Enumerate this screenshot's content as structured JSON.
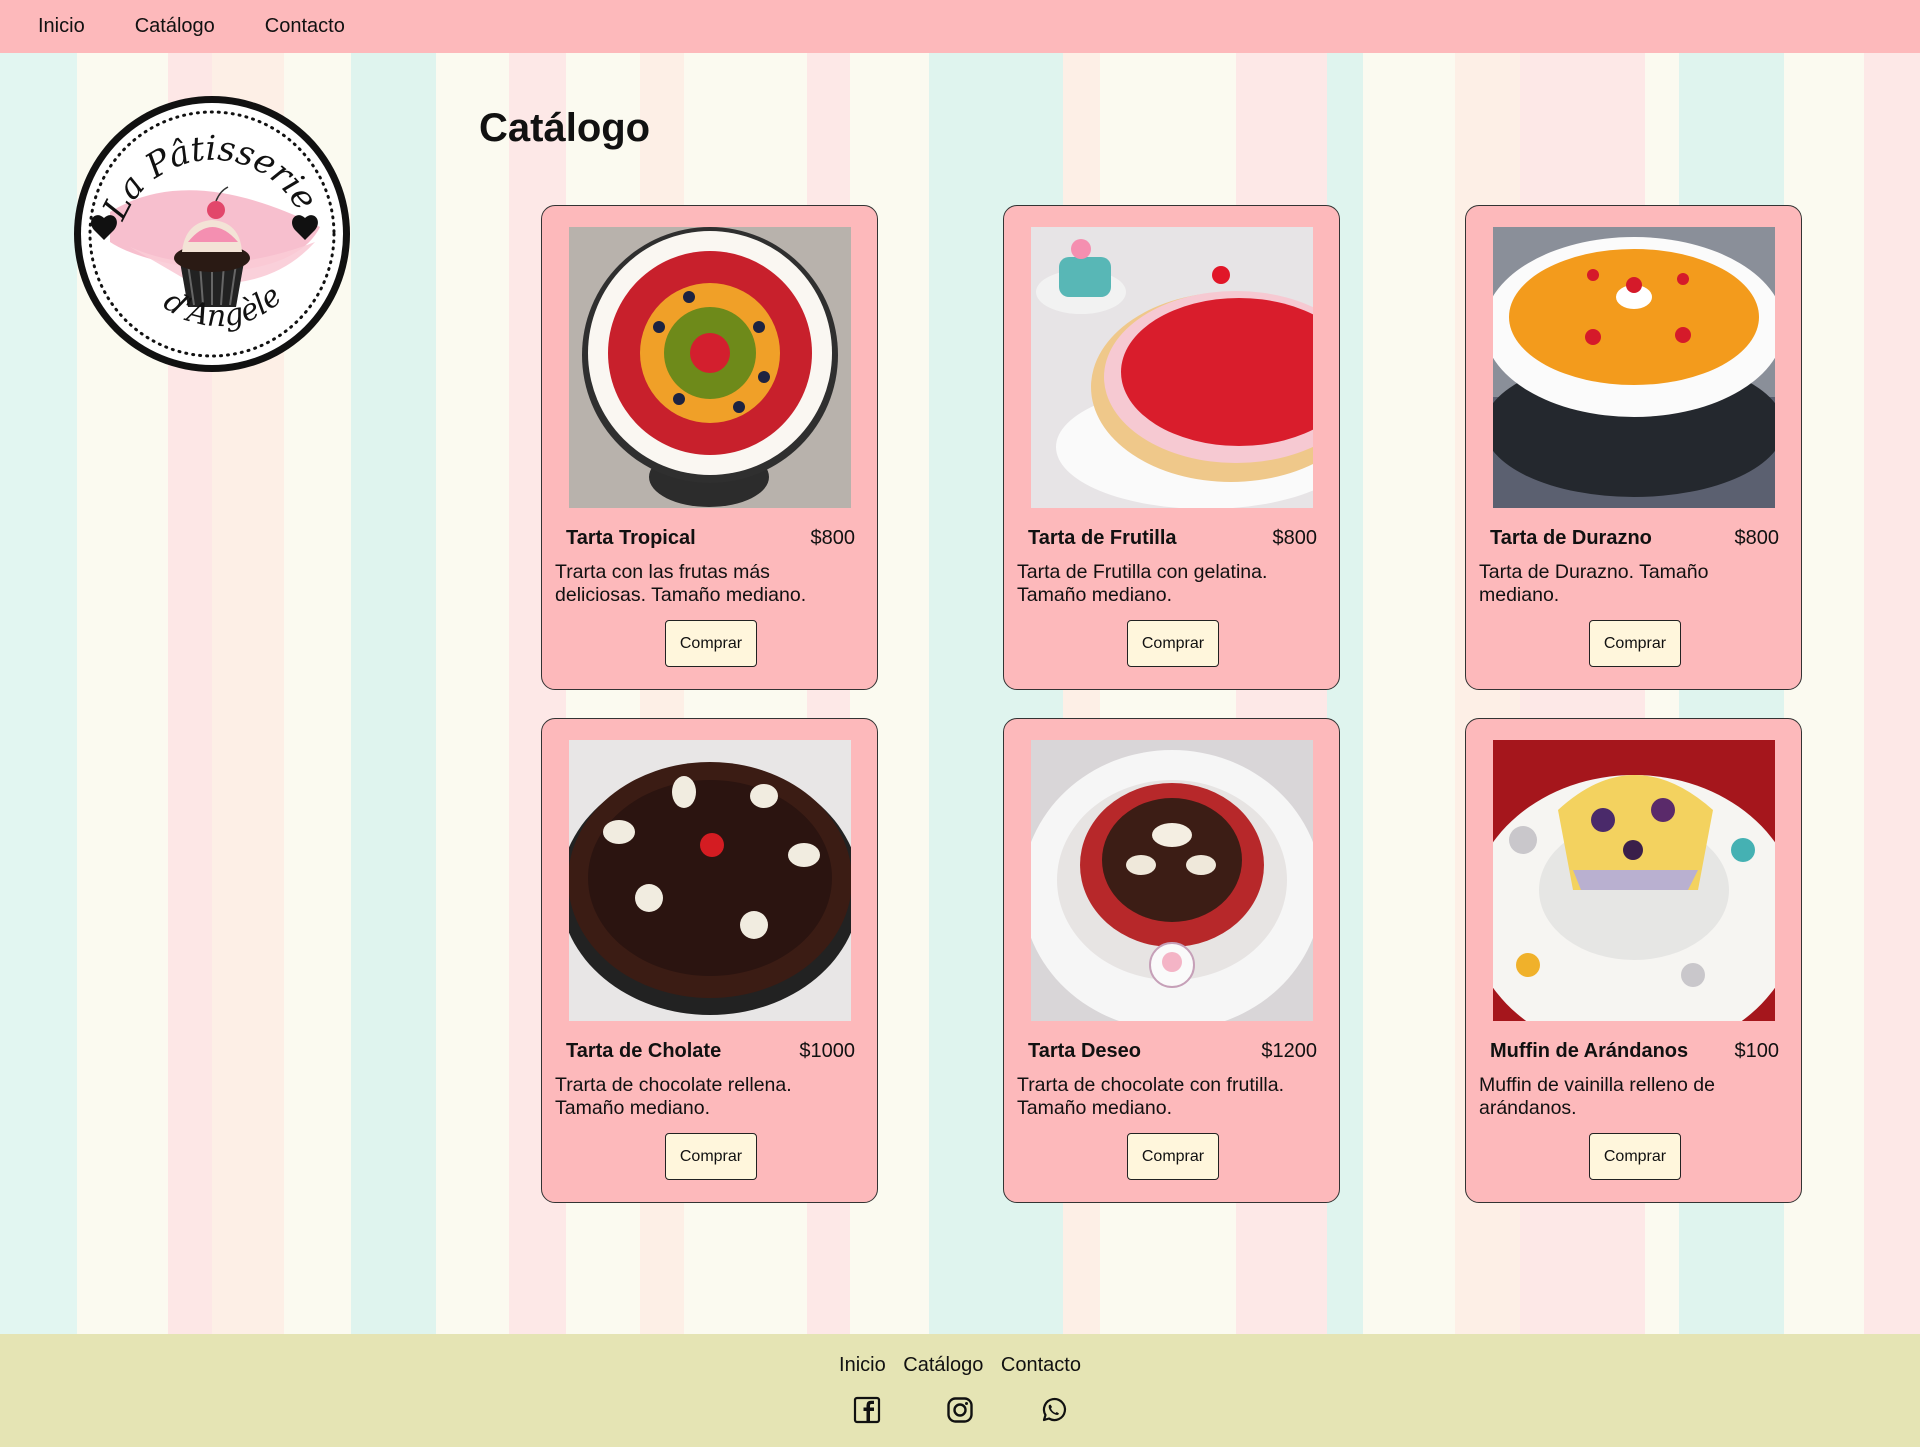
{
  "nav": {
    "items": [
      "Inicio",
      "Catálogo",
      "Contacto"
    ]
  },
  "logo": {
    "line1": "La Pâtisserie",
    "line2": "d'Angèle"
  },
  "page": {
    "title": "Catálogo"
  },
  "products": [
    {
      "name": "Tarta Tropical",
      "price": "$800",
      "description": "Trarta con las frutas más deliciosas. Tamaño mediano.",
      "button": "Comprar",
      "image": "tropical-tart"
    },
    {
      "name": "Tarta de Frutilla",
      "price": "$800",
      "description": "Tarta de Frutilla con gelatina. Tamaño mediano.",
      "button": "Comprar",
      "image": "strawberry-tart"
    },
    {
      "name": "Tarta de Durazno",
      "price": "$800",
      "description": "Tarta de Durazno. Tamaño mediano.",
      "button": "Comprar",
      "image": "peach-tart"
    },
    {
      "name": "Tarta de Cholate",
      "price": "$1000",
      "description": "Trarta de chocolate rellena. Tamaño mediano.",
      "button": "Comprar",
      "image": "chocolate-tart"
    },
    {
      "name": "Tarta Deseo",
      "price": "$1200",
      "description": "Trarta de chocolate con frutilla. Tamaño mediano.",
      "button": "Comprar",
      "image": "chocolate-strawberry-tart"
    },
    {
      "name": "Muffin de Arándanos",
      "price": "$100",
      "description": "Muffin de vainilla relleno de arándanos.",
      "button": "Comprar",
      "image": "blueberry-muffin"
    }
  ],
  "footer": {
    "links": [
      "Inicio",
      "Catálogo",
      "Contacto"
    ],
    "social": [
      "facebook-icon",
      "instagram-icon",
      "whatsapp-icon"
    ]
  },
  "colors": {
    "nav_bg": "#fdb9bb",
    "card_bg": "#fdb9bb",
    "button_bg": "#fff6dc",
    "footer_bg": "#e5e4b4"
  }
}
